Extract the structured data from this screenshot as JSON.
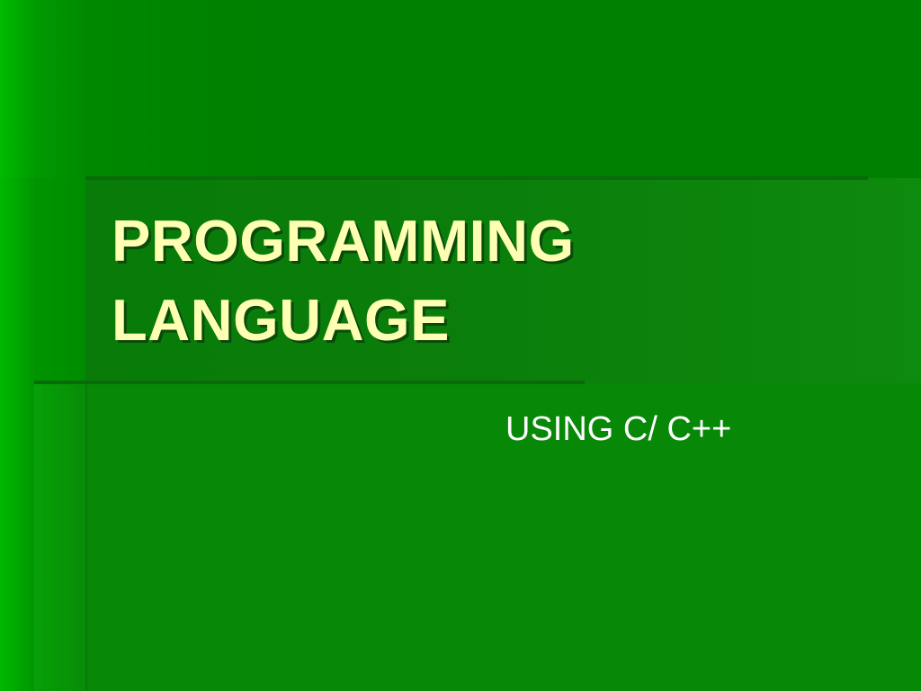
{
  "slide": {
    "title_line1": "PROGRAMMING",
    "title_line2": "LANGUAGE",
    "subtitle": "USING C/ C++"
  },
  "colors": {
    "background": "#008000",
    "title_text": "#ffffb3",
    "subtitle_text": "#ffffff",
    "rule": "#0b6a0b"
  }
}
